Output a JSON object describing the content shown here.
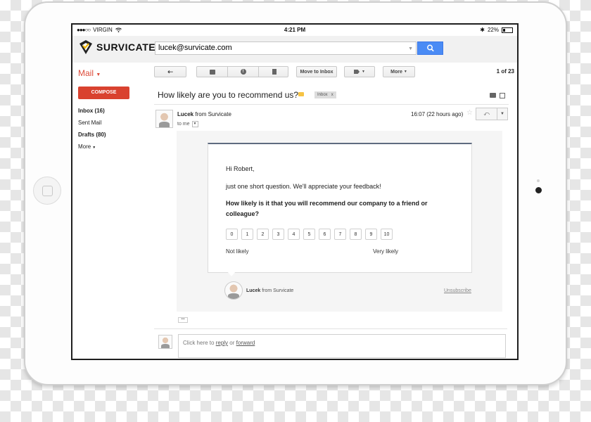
{
  "status_bar": {
    "carrier": "VIRGIN",
    "time": "4:21 PM",
    "battery": "22%"
  },
  "header": {
    "brand": "SURVICATE",
    "search_value": "lucek@survicate.com"
  },
  "toolbar": {
    "mail_label": "Mail",
    "move_to_inbox": "Move to Inbox",
    "more": "More",
    "pager": "1 of 23"
  },
  "sidebar": {
    "compose": "COMPOSE",
    "items": [
      "Inbox (16)",
      "Sent Mail",
      "Drafts (80)",
      "More"
    ]
  },
  "message": {
    "subject": "How likely are you to recommend us?",
    "tag": "Inbox",
    "tag_close": "x",
    "sender_name": "Lucek",
    "sender_suffix": "from Survicate",
    "to": "to me",
    "time": "16:07 (22 hours ago)"
  },
  "survey": {
    "greeting": "Hi Robert,",
    "intro": "just one short question. We'll appreciate your feedback!",
    "question": "How likely is it that you will recommend our company to a friend or colleague?",
    "scores": [
      "0",
      "1",
      "2",
      "3",
      "4",
      "5",
      "6",
      "7",
      "8",
      "9",
      "10"
    ],
    "low_label": "Not likely",
    "high_label": "Very likely",
    "footer_name": "Lucek",
    "footer_suffix": "from Survicate",
    "unsubscribe": "Unsubscribe"
  },
  "reply": {
    "prefix": "Click here to",
    "reply_link": "reply",
    "or": "or",
    "forward_link": "forward"
  },
  "colors": {
    "compose": "#d9422f",
    "search_button": "#4a8bf5",
    "mail_label": "#dd4b39"
  },
  "icons": [
    "survicate-logo-icon",
    "search-icon",
    "back-arrow-icon",
    "archive-icon",
    "spam-icon",
    "trash-icon",
    "label-icon",
    "folder-icon",
    "print-icon",
    "popout-icon",
    "star-icon",
    "reply-icon",
    "wifi-icon",
    "bluetooth-icon",
    "battery-icon"
  ]
}
